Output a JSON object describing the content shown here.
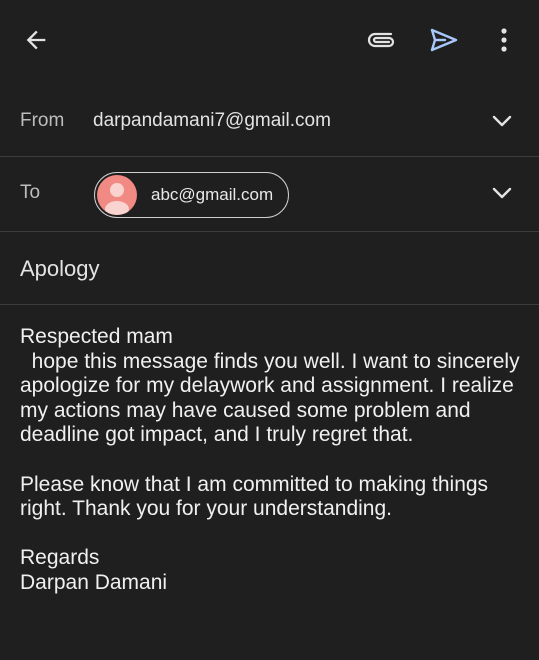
{
  "compose": {
    "from_label": "From",
    "from_email": "darpandamani7@gmail.com",
    "to_label": "To",
    "to_recipient": "abc@gmail.com",
    "subject": "Apology",
    "body": "Respected mam\n  hope this message finds you well. I want to sincerely apologize for my delaywork and assignment. I realize my actions may have caused some problem and deadline got impact, and I truly regret that.\n\nPlease know that I am committed to making things right. Thank you for your understanding.\n\nRegards\nDarpan Damani"
  },
  "icons": {
    "back": "arrow-back-icon",
    "attach": "paperclip-icon",
    "send": "send-icon",
    "more": "more-vert-icon",
    "expand": "chevron-down-icon",
    "avatar": "person-avatar-icon"
  },
  "colors": {
    "background": "#1f1f1f",
    "divider": "#3c3c3c",
    "send_accent": "#a8c7fa",
    "avatar": "#f08a82"
  }
}
